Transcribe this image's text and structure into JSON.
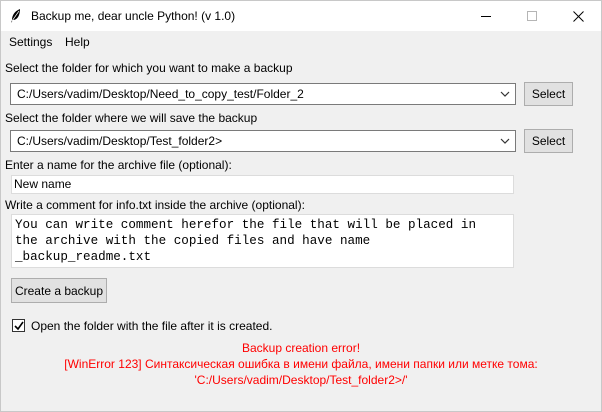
{
  "window": {
    "title": "Backup me, dear uncle Python! (v 1.0)"
  },
  "menu": {
    "items": [
      "Settings",
      "Help"
    ]
  },
  "source": {
    "label": "Select the folder for which you want to make a backup",
    "path": "C:/Users/vadim/Desktop/Need_to_copy_test/Folder_2",
    "button": "Select"
  },
  "destination": {
    "label": "Select the folder where we will save the backup",
    "path": "C:/Users/vadim/Desktop/Test_folder2>",
    "button": "Select"
  },
  "archive_name": {
    "label": "Enter a name for the archive file (optional):",
    "value": "New name"
  },
  "comment": {
    "label": "Write a comment for info.txt inside the archive (optional):",
    "lines": [
      "You can write comment herefor the file that will be placed in",
      "the archive with the copied files and have name",
      "_backup_readme.txt"
    ]
  },
  "create_button": "Create a backup",
  "open_folder": {
    "label": "Open the folder with the file after it is created.",
    "checked": true
  },
  "error": {
    "line1": "Backup creation error!",
    "line2": "[WinError 123] Синтаксическая ошибка в имени файла, имени папки или метке тома:",
    "line3": "'C:/Users/vadim/Desktop/Test_folder2>/'",
    "color": "#ff0000"
  }
}
